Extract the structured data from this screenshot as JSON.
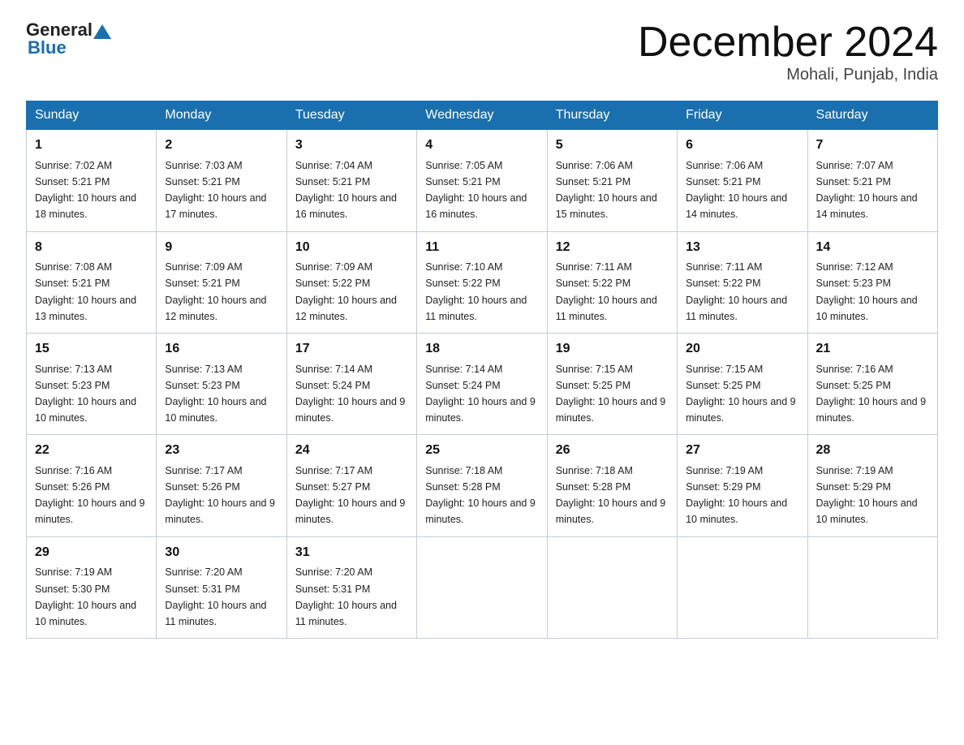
{
  "header": {
    "logo_general": "General",
    "logo_blue": "Blue",
    "title": "December 2024",
    "location": "Mohali, Punjab, India"
  },
  "days_of_week": [
    "Sunday",
    "Monday",
    "Tuesday",
    "Wednesday",
    "Thursday",
    "Friday",
    "Saturday"
  ],
  "weeks": [
    [
      {
        "day": 1,
        "sunrise": "7:02 AM",
        "sunset": "5:21 PM",
        "daylight": "10 hours and 18 minutes."
      },
      {
        "day": 2,
        "sunrise": "7:03 AM",
        "sunset": "5:21 PM",
        "daylight": "10 hours and 17 minutes."
      },
      {
        "day": 3,
        "sunrise": "7:04 AM",
        "sunset": "5:21 PM",
        "daylight": "10 hours and 16 minutes."
      },
      {
        "day": 4,
        "sunrise": "7:05 AM",
        "sunset": "5:21 PM",
        "daylight": "10 hours and 16 minutes."
      },
      {
        "day": 5,
        "sunrise": "7:06 AM",
        "sunset": "5:21 PM",
        "daylight": "10 hours and 15 minutes."
      },
      {
        "day": 6,
        "sunrise": "7:06 AM",
        "sunset": "5:21 PM",
        "daylight": "10 hours and 14 minutes."
      },
      {
        "day": 7,
        "sunrise": "7:07 AM",
        "sunset": "5:21 PM",
        "daylight": "10 hours and 14 minutes."
      }
    ],
    [
      {
        "day": 8,
        "sunrise": "7:08 AM",
        "sunset": "5:21 PM",
        "daylight": "10 hours and 13 minutes."
      },
      {
        "day": 9,
        "sunrise": "7:09 AM",
        "sunset": "5:21 PM",
        "daylight": "10 hours and 12 minutes."
      },
      {
        "day": 10,
        "sunrise": "7:09 AM",
        "sunset": "5:22 PM",
        "daylight": "10 hours and 12 minutes."
      },
      {
        "day": 11,
        "sunrise": "7:10 AM",
        "sunset": "5:22 PM",
        "daylight": "10 hours and 11 minutes."
      },
      {
        "day": 12,
        "sunrise": "7:11 AM",
        "sunset": "5:22 PM",
        "daylight": "10 hours and 11 minutes."
      },
      {
        "day": 13,
        "sunrise": "7:11 AM",
        "sunset": "5:22 PM",
        "daylight": "10 hours and 11 minutes."
      },
      {
        "day": 14,
        "sunrise": "7:12 AM",
        "sunset": "5:23 PM",
        "daylight": "10 hours and 10 minutes."
      }
    ],
    [
      {
        "day": 15,
        "sunrise": "7:13 AM",
        "sunset": "5:23 PM",
        "daylight": "10 hours and 10 minutes."
      },
      {
        "day": 16,
        "sunrise": "7:13 AM",
        "sunset": "5:23 PM",
        "daylight": "10 hours and 10 minutes."
      },
      {
        "day": 17,
        "sunrise": "7:14 AM",
        "sunset": "5:24 PM",
        "daylight": "10 hours and 9 minutes."
      },
      {
        "day": 18,
        "sunrise": "7:14 AM",
        "sunset": "5:24 PM",
        "daylight": "10 hours and 9 minutes."
      },
      {
        "day": 19,
        "sunrise": "7:15 AM",
        "sunset": "5:25 PM",
        "daylight": "10 hours and 9 minutes."
      },
      {
        "day": 20,
        "sunrise": "7:15 AM",
        "sunset": "5:25 PM",
        "daylight": "10 hours and 9 minutes."
      },
      {
        "day": 21,
        "sunrise": "7:16 AM",
        "sunset": "5:25 PM",
        "daylight": "10 hours and 9 minutes."
      }
    ],
    [
      {
        "day": 22,
        "sunrise": "7:16 AM",
        "sunset": "5:26 PM",
        "daylight": "10 hours and 9 minutes."
      },
      {
        "day": 23,
        "sunrise": "7:17 AM",
        "sunset": "5:26 PM",
        "daylight": "10 hours and 9 minutes."
      },
      {
        "day": 24,
        "sunrise": "7:17 AM",
        "sunset": "5:27 PM",
        "daylight": "10 hours and 9 minutes."
      },
      {
        "day": 25,
        "sunrise": "7:18 AM",
        "sunset": "5:28 PM",
        "daylight": "10 hours and 9 minutes."
      },
      {
        "day": 26,
        "sunrise": "7:18 AM",
        "sunset": "5:28 PM",
        "daylight": "10 hours and 9 minutes."
      },
      {
        "day": 27,
        "sunrise": "7:19 AM",
        "sunset": "5:29 PM",
        "daylight": "10 hours and 10 minutes."
      },
      {
        "day": 28,
        "sunrise": "7:19 AM",
        "sunset": "5:29 PM",
        "daylight": "10 hours and 10 minutes."
      }
    ],
    [
      {
        "day": 29,
        "sunrise": "7:19 AM",
        "sunset": "5:30 PM",
        "daylight": "10 hours and 10 minutes."
      },
      {
        "day": 30,
        "sunrise": "7:20 AM",
        "sunset": "5:31 PM",
        "daylight": "10 hours and 11 minutes."
      },
      {
        "day": 31,
        "sunrise": "7:20 AM",
        "sunset": "5:31 PM",
        "daylight": "10 hours and 11 minutes."
      },
      null,
      null,
      null,
      null
    ]
  ]
}
